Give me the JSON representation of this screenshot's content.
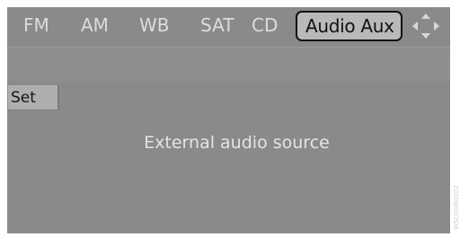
{
  "tabs": [
    {
      "label": "FM",
      "active": false
    },
    {
      "label": "AM",
      "active": false
    },
    {
      "label": "WB",
      "active": false
    },
    {
      "label": "SAT",
      "active": false
    },
    {
      "label": "CD",
      "active": false
    },
    {
      "label": "Audio Aux",
      "active": true
    }
  ],
  "nav_icon": "four-way-arrows-icon",
  "set_button": {
    "label": "Set"
  },
  "message": "External audio source",
  "watermark": "W5CDGB0202",
  "colors": {
    "screen_bg": "#8a8a8a",
    "active_tab_bg": "#b9b9b9",
    "text_light": "#dcdcdc",
    "text_dark": "#111111"
  }
}
